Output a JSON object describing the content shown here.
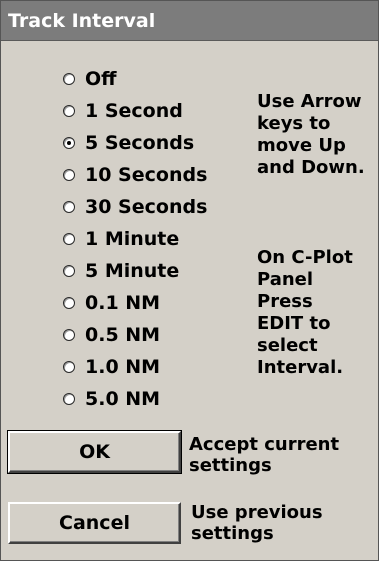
{
  "window": {
    "title": "Track Interval"
  },
  "options": [
    {
      "label": "Off",
      "checked": false
    },
    {
      "label": "1 Second",
      "checked": false
    },
    {
      "label": "5 Seconds",
      "checked": true
    },
    {
      "label": "10 Seconds",
      "checked": false
    },
    {
      "label": "30 Seconds",
      "checked": false
    },
    {
      "label": "1 Minute",
      "checked": false
    },
    {
      "label": "5 Minute",
      "checked": false
    },
    {
      "label": "0.1 NM",
      "checked": false
    },
    {
      "label": "0.5 NM",
      "checked": false
    },
    {
      "label": "1.0 NM",
      "checked": false
    },
    {
      "label": "5.0 NM",
      "checked": false
    }
  ],
  "help": {
    "arrows": "Use Arrow\nkeys to\nmove Up\nand Down.",
    "panel": "On C-Plot\nPanel\nPress\nEDIT to\nselect\nInterval."
  },
  "buttons": {
    "ok_label": "OK",
    "ok_desc": "Accept current\nsettings",
    "cancel_label": "Cancel",
    "cancel_desc": "Use previous\nsettings"
  }
}
